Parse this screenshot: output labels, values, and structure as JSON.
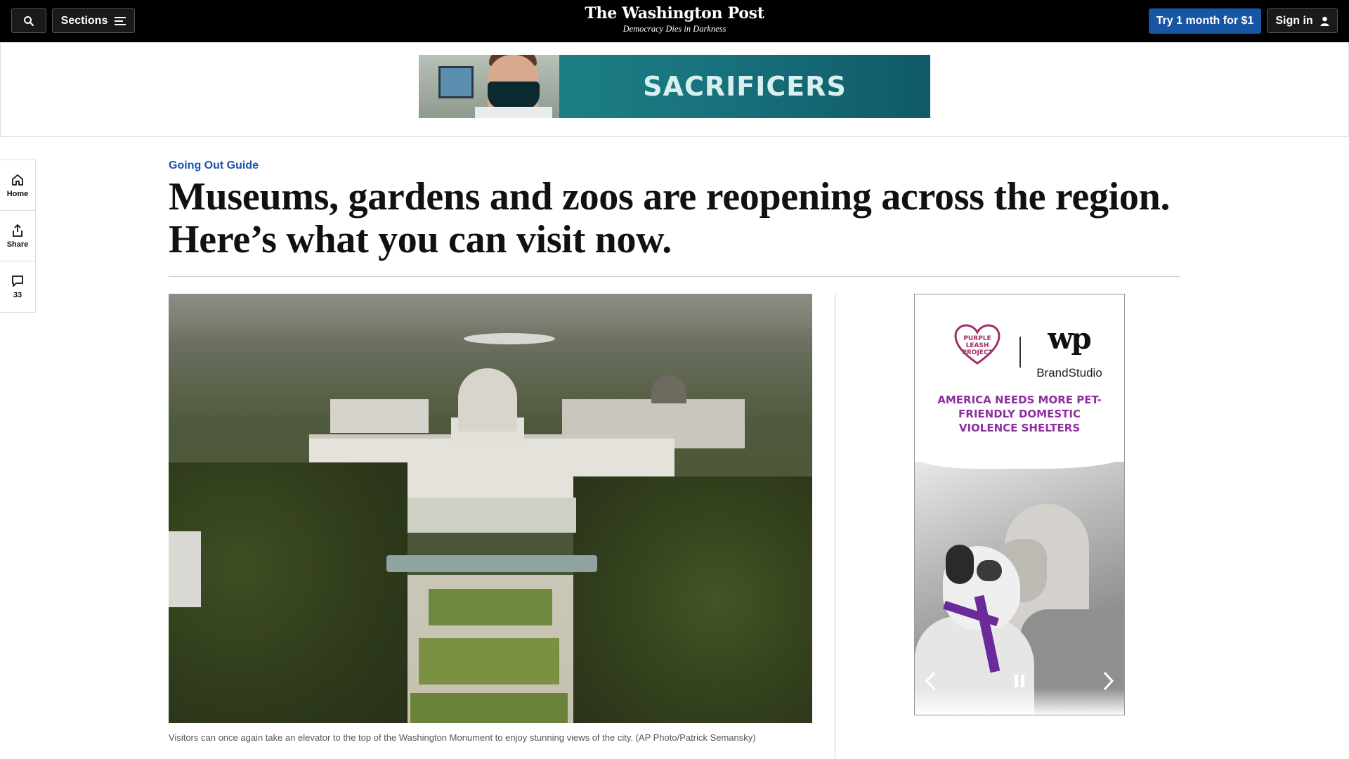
{
  "nav": {
    "sections_label": "Sections",
    "logo": "The Washington Post",
    "tagline": "Democracy Dies in Darkness",
    "subscribe_label": "Try 1 month for $1",
    "signin_label": "Sign in"
  },
  "top_ad": {
    "text": "SACRIFICERS"
  },
  "rail": {
    "home_label": "Home",
    "share_label": "Share",
    "comments_count": "33"
  },
  "article": {
    "kicker": "Going Out Guide",
    "headline": "Museums, gardens and zoos are reopening across the region. Here’s what you can visit now.",
    "caption": "Visitors can once again take an elevator to the top of the Washington Monument to enjoy stunning views of the city. (AP Photo/Patrick Semansky)"
  },
  "side_ad": {
    "partner_logo": "PURPLE LEASH PROJECT",
    "brand": "BrandStudio",
    "wp_mark": "wp",
    "headline": "AMERICA NEEDS MORE PET-FRIENDLY DOMESTIC VIOLENCE SHELTERS"
  },
  "colors": {
    "accent": "#1955a5",
    "nav_bg": "#000000",
    "ad_purple": "#8e2f9e"
  },
  "icons": {
    "search": "search-icon",
    "menu": "menu-icon",
    "user": "user-icon",
    "home": "home-icon",
    "share": "share-icon",
    "comment": "comment-icon",
    "prev": "chevron-left-icon",
    "next": "chevron-right-icon",
    "pause": "pause-icon"
  }
}
